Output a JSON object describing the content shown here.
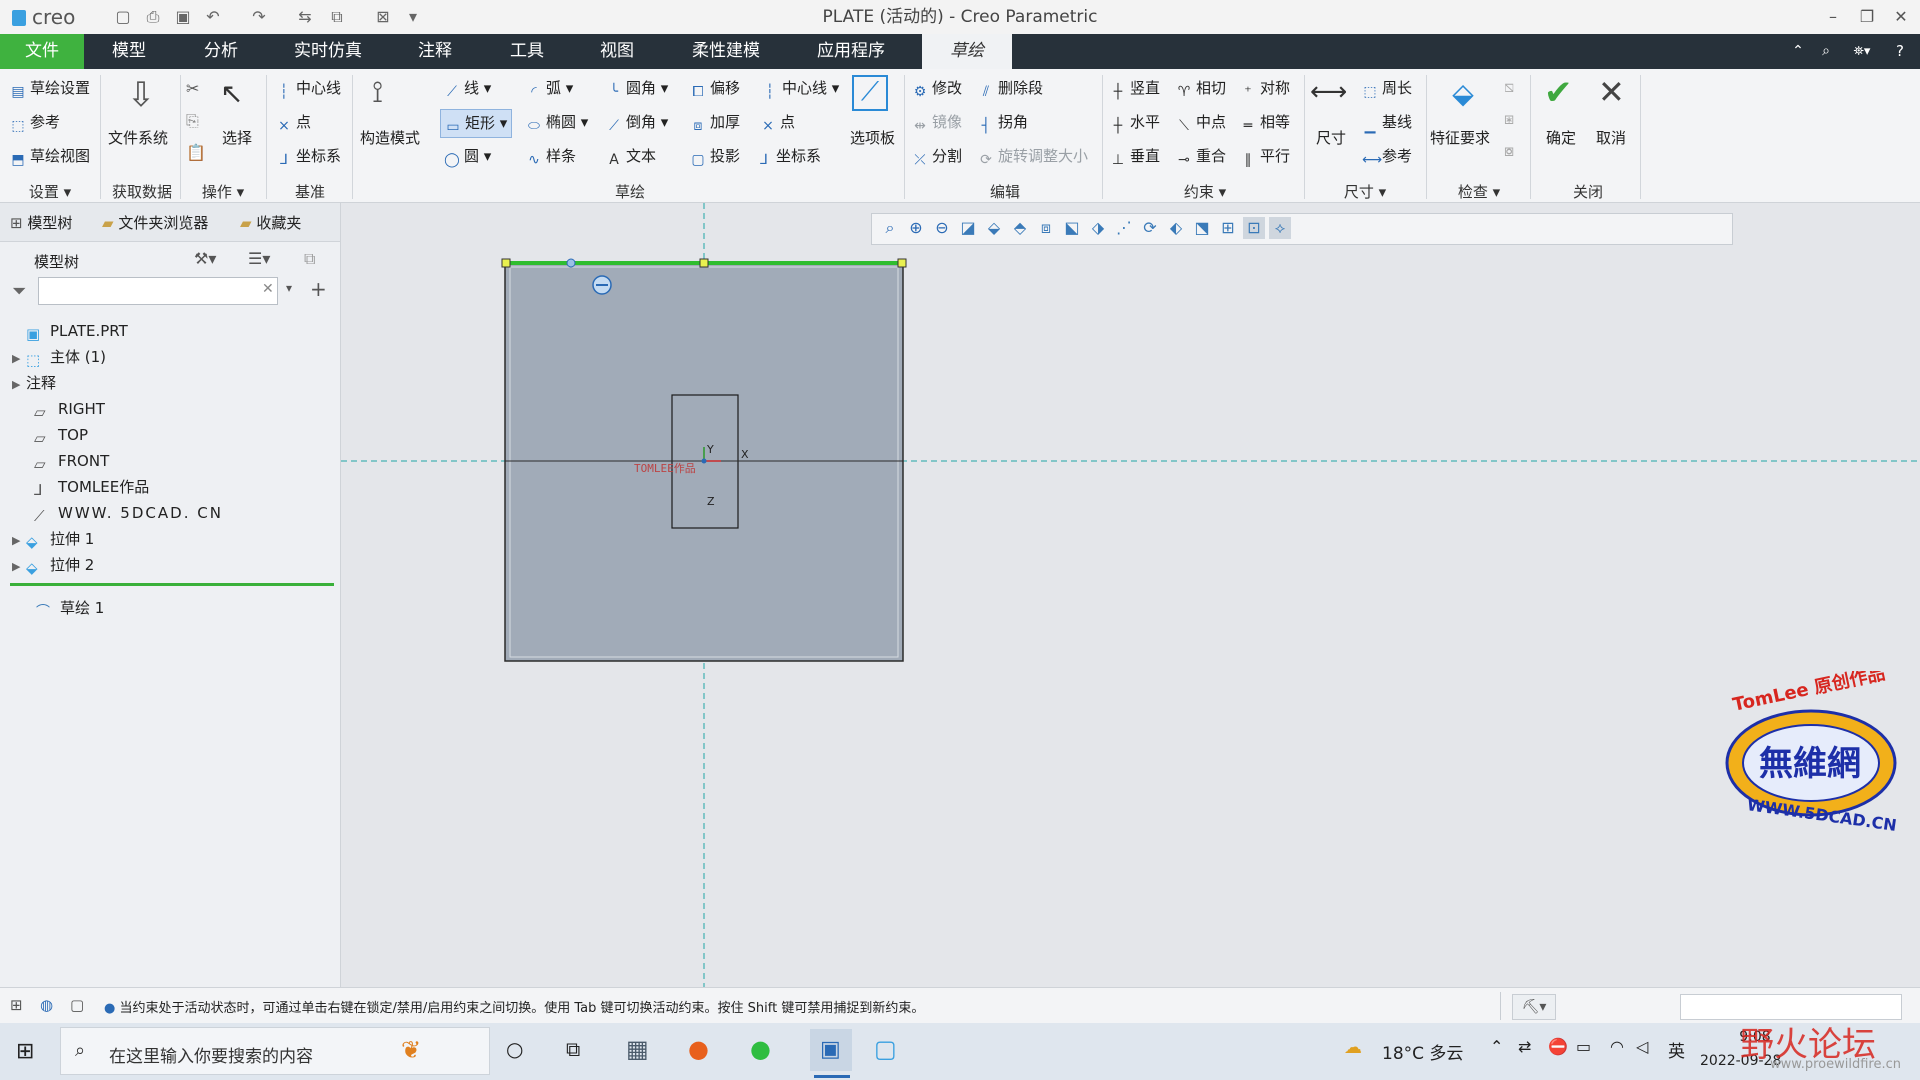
{
  "app": {
    "logo_text": "creo",
    "window_title": "PLATE (活动的) - Creo Parametric"
  },
  "menu": {
    "file": "文件",
    "items": [
      "模型",
      "分析",
      "实时仿真",
      "注释",
      "工具",
      "视图",
      "柔性建模",
      "应用程序"
    ],
    "active": "草绘"
  },
  "ribbon": {
    "setup": {
      "sketch_setup": "草绘设置",
      "reference": "参考",
      "sketch_view": "草绘视图",
      "label": "设置"
    },
    "get_data": {
      "file_system": "文件系统",
      "label": "获取数据"
    },
    "operations": {
      "select": "选择",
      "label": "操作"
    },
    "datum": {
      "centerline": "中心线",
      "point": "点",
      "coord_sys": "坐标系",
      "label": "基准"
    },
    "construction": {
      "mode": "构造模式"
    },
    "sketching": {
      "line": "线",
      "arc": "弧",
      "fillet": "圆角",
      "offset": "偏移",
      "centerline": "中心线",
      "rectangle": "矩形",
      "ellipse": "椭圆",
      "chamfer": "倒角",
      "thicken": "加厚",
      "point": "点",
      "circle": "圆",
      "spline": "样条",
      "text": "文本",
      "project": "投影",
      "coord_sys": "坐标系",
      "palette": "选项板",
      "label": "草绘"
    },
    "editing": {
      "modify": "修改",
      "delete_segment": "删除段",
      "mirror": "镜像",
      "corner": "拐角",
      "divide": "分割",
      "rotate_resize": "旋转调整大小",
      "label": "编辑"
    },
    "constrain": {
      "vertical": "竖直",
      "tangent": "相切",
      "symmetric": "对称",
      "horizontal": "水平",
      "midpoint": "中点",
      "equal": "相等",
      "perpendicular": "垂直",
      "coincident": "重合",
      "parallel": "平行",
      "label": "约束"
    },
    "dimension": {
      "dimension": "尺寸",
      "perimeter": "周长",
      "baseline": "基线",
      "reference": "参考",
      "label": "尺寸"
    },
    "inspect": {
      "feature_requirements": "特征要求",
      "label": "检查"
    },
    "close": {
      "ok": "确定",
      "cancel": "取消",
      "label": "关闭"
    }
  },
  "left_panel": {
    "tabs": [
      "模型树",
      "文件夹浏览器",
      "收藏夹"
    ],
    "tree_header": "模型树",
    "search_placeholder": "",
    "items": [
      {
        "label": "PLATE.PRT",
        "expandable": false,
        "indent": 0
      },
      {
        "label": "主体 (1)",
        "expandable": true,
        "indent": 1
      },
      {
        "label": "注释",
        "expandable": true,
        "indent": 0
      },
      {
        "label": "RIGHT",
        "expandable": false,
        "indent": 1
      },
      {
        "label": "TOP",
        "expandable": false,
        "indent": 1
      },
      {
        "label": "FRONT",
        "expandable": false,
        "indent": 1
      },
      {
        "label": "TOMLEE作品",
        "expandable": false,
        "indent": 1
      },
      {
        "label": "WWW. 5DCAD. CN",
        "expandable": false,
        "indent": 1
      },
      {
        "label": "拉伸 1",
        "expandable": true,
        "indent": 1
      },
      {
        "label": "拉伸 2",
        "expandable": true,
        "indent": 1
      }
    ],
    "active_item": "草绘 1"
  },
  "canvas": {
    "csys_name": "TOMLEE作品",
    "axis_x": "X",
    "axis_y": "Y",
    "axis_z": "Z"
  },
  "status": {
    "message": "当约束处于活动状态时，可通过单击右键在锁定/禁用/启用约束之间切换。使用 Tab 键可切换活动约束。按住 Shift 键可禁用捕捉到新约束。"
  },
  "watermark": {
    "brand": "TomLee 原创作品",
    "site_name": "無維網",
    "url": "WWW.5DCAD.CN",
    "forum": "野火论坛",
    "forum_url": "www.proewildfire.cn"
  },
  "taskbar": {
    "search_placeholder": "在这里输入你要搜索的内容",
    "weather": "18°C 多云",
    "ime": "英",
    "time": "9:08",
    "date": "2022-09-28"
  },
  "colors": {
    "menubar": "#27313a",
    "file_tab": "#3fb23f",
    "sketch_line": "#2fbd2f",
    "part_fill": "#a1abb8",
    "accent": "#2a6ab5"
  }
}
